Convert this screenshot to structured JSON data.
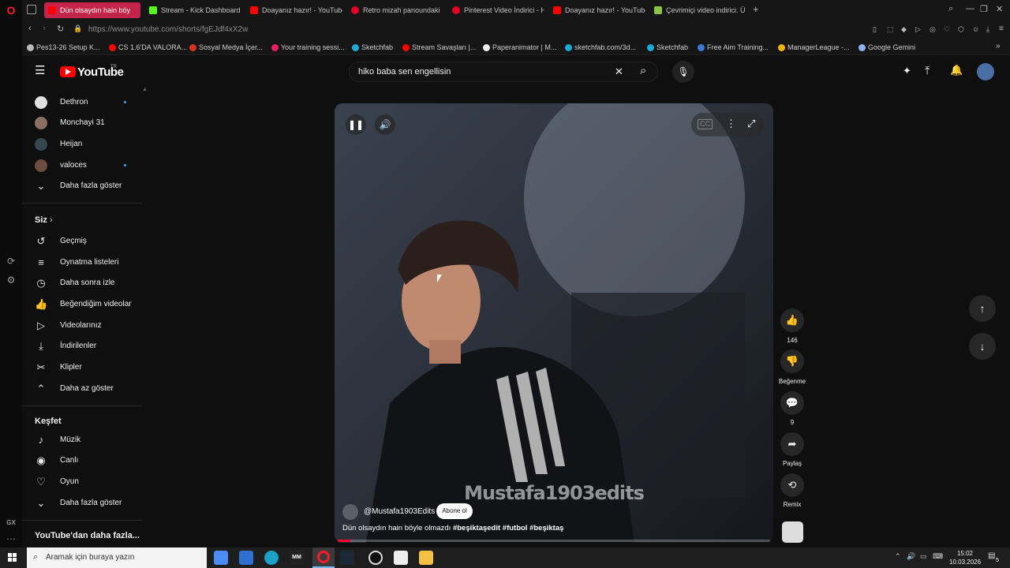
{
  "browser": {
    "tabs": [
      {
        "title": "Dün olsaydın hain böy",
        "active": true,
        "favicon_color": "#ff0000"
      },
      {
        "title": "Stream - Kick Dashboard",
        "favicon_color": "#53fc18"
      },
      {
        "title": "Doayanız hazır! - YouTube",
        "favicon_color": "#ff0000"
      },
      {
        "title": "Retro mizah panoundaki",
        "favicon_color": "#e60023"
      },
      {
        "title": "Pinterest Video İndirici - H",
        "favicon_color": "#e60023"
      },
      {
        "title": "Doayanız hazır! - YouTube",
        "favicon_color": "#ff0000"
      },
      {
        "title": "Çevrimiçi video indirici. Ü",
        "favicon_color": "#8bc34a"
      }
    ],
    "url": "https://www.youtube.com/shorts/fgEJdf4xX2w",
    "bookmarks": [
      {
        "label": "Pes13-26 Setup K...",
        "color": "#bbbbbb"
      },
      {
        "label": "CS 1.6'DA VALORA...",
        "color": "#ff0000"
      },
      {
        "label": "Sosyal Medya İçer...",
        "color": "#d93025"
      },
      {
        "label": "Your training sessi...",
        "color": "#e91e63"
      },
      {
        "label": "Sketchfab",
        "color": "#1caad9"
      },
      {
        "label": "Stream Savaşları |...",
        "color": "#ff0000"
      },
      {
        "label": "Paperanimator | M...",
        "color": "#eeeeee"
      },
      {
        "label": "sketchfab.com/3d...",
        "color": "#1caad9"
      },
      {
        "label": "Sketchfab",
        "color": "#1caad9"
      },
      {
        "label": "Free Aim Training...",
        "color": "#3a7bd5"
      },
      {
        "label": "ManagerLeague -...",
        "color": "#f4b400"
      },
      {
        "label": "Google Gemini",
        "color": "#8ab4f8"
      }
    ]
  },
  "header": {
    "logo": "YouTube",
    "logo_region": "TR",
    "search_value": "hiko baba sen  engellisin"
  },
  "sidebar": {
    "subscriptions": [
      {
        "label": "Dethron",
        "new": true,
        "avatar_color": "#e0e0e0"
      },
      {
        "label": "Monchayi 31",
        "new": false,
        "avatar_color": "#8d6e63"
      },
      {
        "label": "Heijan",
        "new": false,
        "avatar_color": "#37474f"
      },
      {
        "label": "valoces",
        "new": true,
        "avatar_color": "#6d4c41"
      }
    ],
    "show_more_1": "Daha fazla göster",
    "you_title": "Siz",
    "you_items": [
      {
        "label": "Geçmiş",
        "icon": "history-icon"
      },
      {
        "label": "Oynatma listeleri",
        "icon": "playlists-icon"
      },
      {
        "label": "Daha sonra izle",
        "icon": "watch-later-icon"
      },
      {
        "label": "Beğendiğim videolar",
        "icon": "liked-icon"
      },
      {
        "label": "Videolarınız",
        "icon": "your-videos-icon"
      },
      {
        "label": "İndirilenler",
        "icon": "downloads-icon"
      },
      {
        "label": "Klipler",
        "icon": "clips-icon"
      }
    ],
    "show_less": "Daha az göster",
    "explore_title": "Keşfet",
    "explore_items": [
      {
        "label": "Müzik",
        "icon": "music-icon"
      },
      {
        "label": "Canlı",
        "icon": "live-icon"
      },
      {
        "label": "Oyun",
        "icon": "gaming-icon"
      }
    ],
    "show_more_2": "Daha fazla göster",
    "more_title": "YouTube'dan daha fazla..."
  },
  "short": {
    "channel": "@Mustafa1903Edits",
    "subscribe_label": "Abone ol",
    "caption_plain": "Dün olsaydın hain böyle olmazdı ",
    "hashtags": "#beşiktaşedit #futbol #beşiktaş",
    "watermark": "Mustafa1903edits",
    "progress_fraction": 0.03
  },
  "actions": {
    "likes": "146",
    "dislike_label": "Beğenme",
    "comments": "9",
    "share_label": "Paylaş",
    "remix_label": "Remix"
  },
  "taskbar": {
    "search_placeholder": "Aramak için buraya yazın",
    "time": "15:02",
    "date": "10.03.2026",
    "notification_count": "5"
  }
}
